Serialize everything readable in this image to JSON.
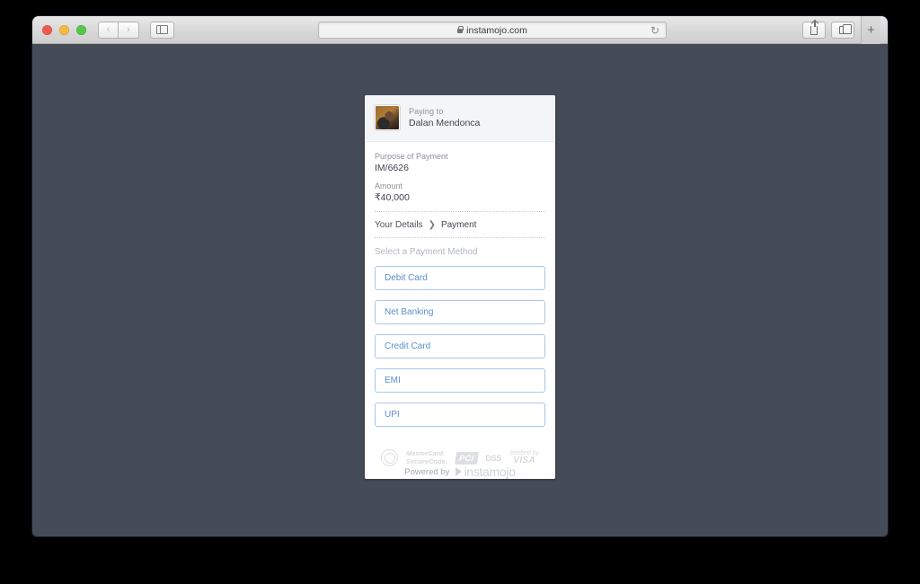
{
  "browser": {
    "url": "instamojo.com",
    "lock_icon": "lock-icon",
    "reload_icon": "↻",
    "back_icon": "‹",
    "forward_icon": "›",
    "sidebar_icon": "sidebar-toggle-icon",
    "share_icon": "share-icon",
    "tabs_icon": "tabs-overview-icon",
    "new_tab_icon": "+"
  },
  "card": {
    "paying_to_label": "Paying to",
    "payee_name": "Dalan Mendonca",
    "fields": [
      {
        "label": "Purpose of Payment",
        "value": "IM/6626"
      },
      {
        "label": "Amount",
        "value": "₹40,000"
      }
    ],
    "breadcrumb": {
      "step_one": "Your Details",
      "separator": "❯",
      "step_two": "Payment"
    },
    "select_method_label": "Select a Payment Method",
    "methods": [
      {
        "label": "Debit Card"
      },
      {
        "label": "Net Banking"
      },
      {
        "label": "Credit Card"
      },
      {
        "label": "EMI"
      },
      {
        "label": "UPI"
      }
    ],
    "badges": {
      "seal": "security-seal-icon",
      "mastercard_line1": "MasterCard.",
      "mastercard_line2": "SecureCode.",
      "pci": "PCI",
      "dss": "DSS",
      "visa_line1": "Verified by",
      "visa_line2": "VISA"
    }
  },
  "footer": {
    "powered_by": "Powered by",
    "brand": "instamojo"
  },
  "colors": {
    "page_background": "#454b57",
    "card_background": "#ffffff",
    "card_header": "#f4f5f7",
    "method_border": "#a7c8ec",
    "method_text": "#5b8fc9",
    "label_text": "#8b919b",
    "value_text": "#3f4450"
  }
}
